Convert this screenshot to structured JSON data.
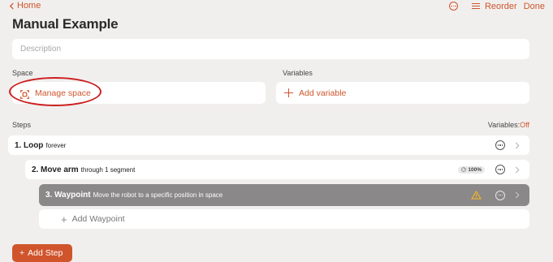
{
  "nav": {
    "back_label": "Home",
    "reorder_label": "Reorder",
    "done_label": "Done"
  },
  "page": {
    "title": "Manual Example",
    "description_placeholder": "Description"
  },
  "space": {
    "section_label": "Space",
    "button_label": "Manage space"
  },
  "variables": {
    "section_label": "Variables",
    "button_label": "Add variable"
  },
  "steps": {
    "section_label": "Steps",
    "variables_toggle_label": "Variables:",
    "variables_toggle_value": "Off",
    "items": [
      {
        "number": "1.",
        "name": "Loop",
        "description": "forever"
      },
      {
        "number": "2.",
        "name": "Move arm",
        "description": "through 1 segment",
        "badge": "100%"
      },
      {
        "number": "3.",
        "name": "Waypoint",
        "description": "Move the robot to a specific position in space"
      }
    ],
    "add_waypoint_label": "Add Waypoint",
    "add_step_label": "Add Step"
  },
  "colors": {
    "accent": "#d0552c",
    "background": "#f1efee",
    "selected_row": "#8a8888",
    "annotation": "#cc1f1f",
    "warning": "#f0b429"
  },
  "icons": [
    "chevron-left-icon",
    "more-icon",
    "reorder-icon",
    "manage-space-icon",
    "plus-icon",
    "chevron-right-icon",
    "warning-icon",
    "gauge-icon"
  ]
}
